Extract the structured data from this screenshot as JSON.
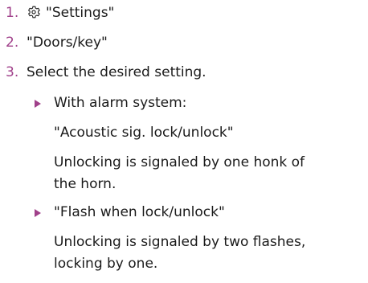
{
  "steps": [
    {
      "number": "1.",
      "icon": "gear-icon",
      "text": "\"Settings\""
    },
    {
      "number": "2.",
      "text": "\"Doors/key\""
    },
    {
      "number": "3.",
      "text": "Select the desired setting."
    }
  ],
  "options": [
    {
      "lines": [
        "With alarm system:",
        "\"Acoustic sig. lock/unlock\""
      ],
      "description": [
        "Unlocking is signaled by one honk of",
        "the horn."
      ]
    },
    {
      "lines": [
        "\"Flash when lock/unlock\""
      ],
      "description": [
        "Unlocking is signaled by two flashes,",
        "locking by one."
      ]
    }
  ],
  "colors": {
    "accent": "#a0408a",
    "text": "#1a1a1a"
  }
}
